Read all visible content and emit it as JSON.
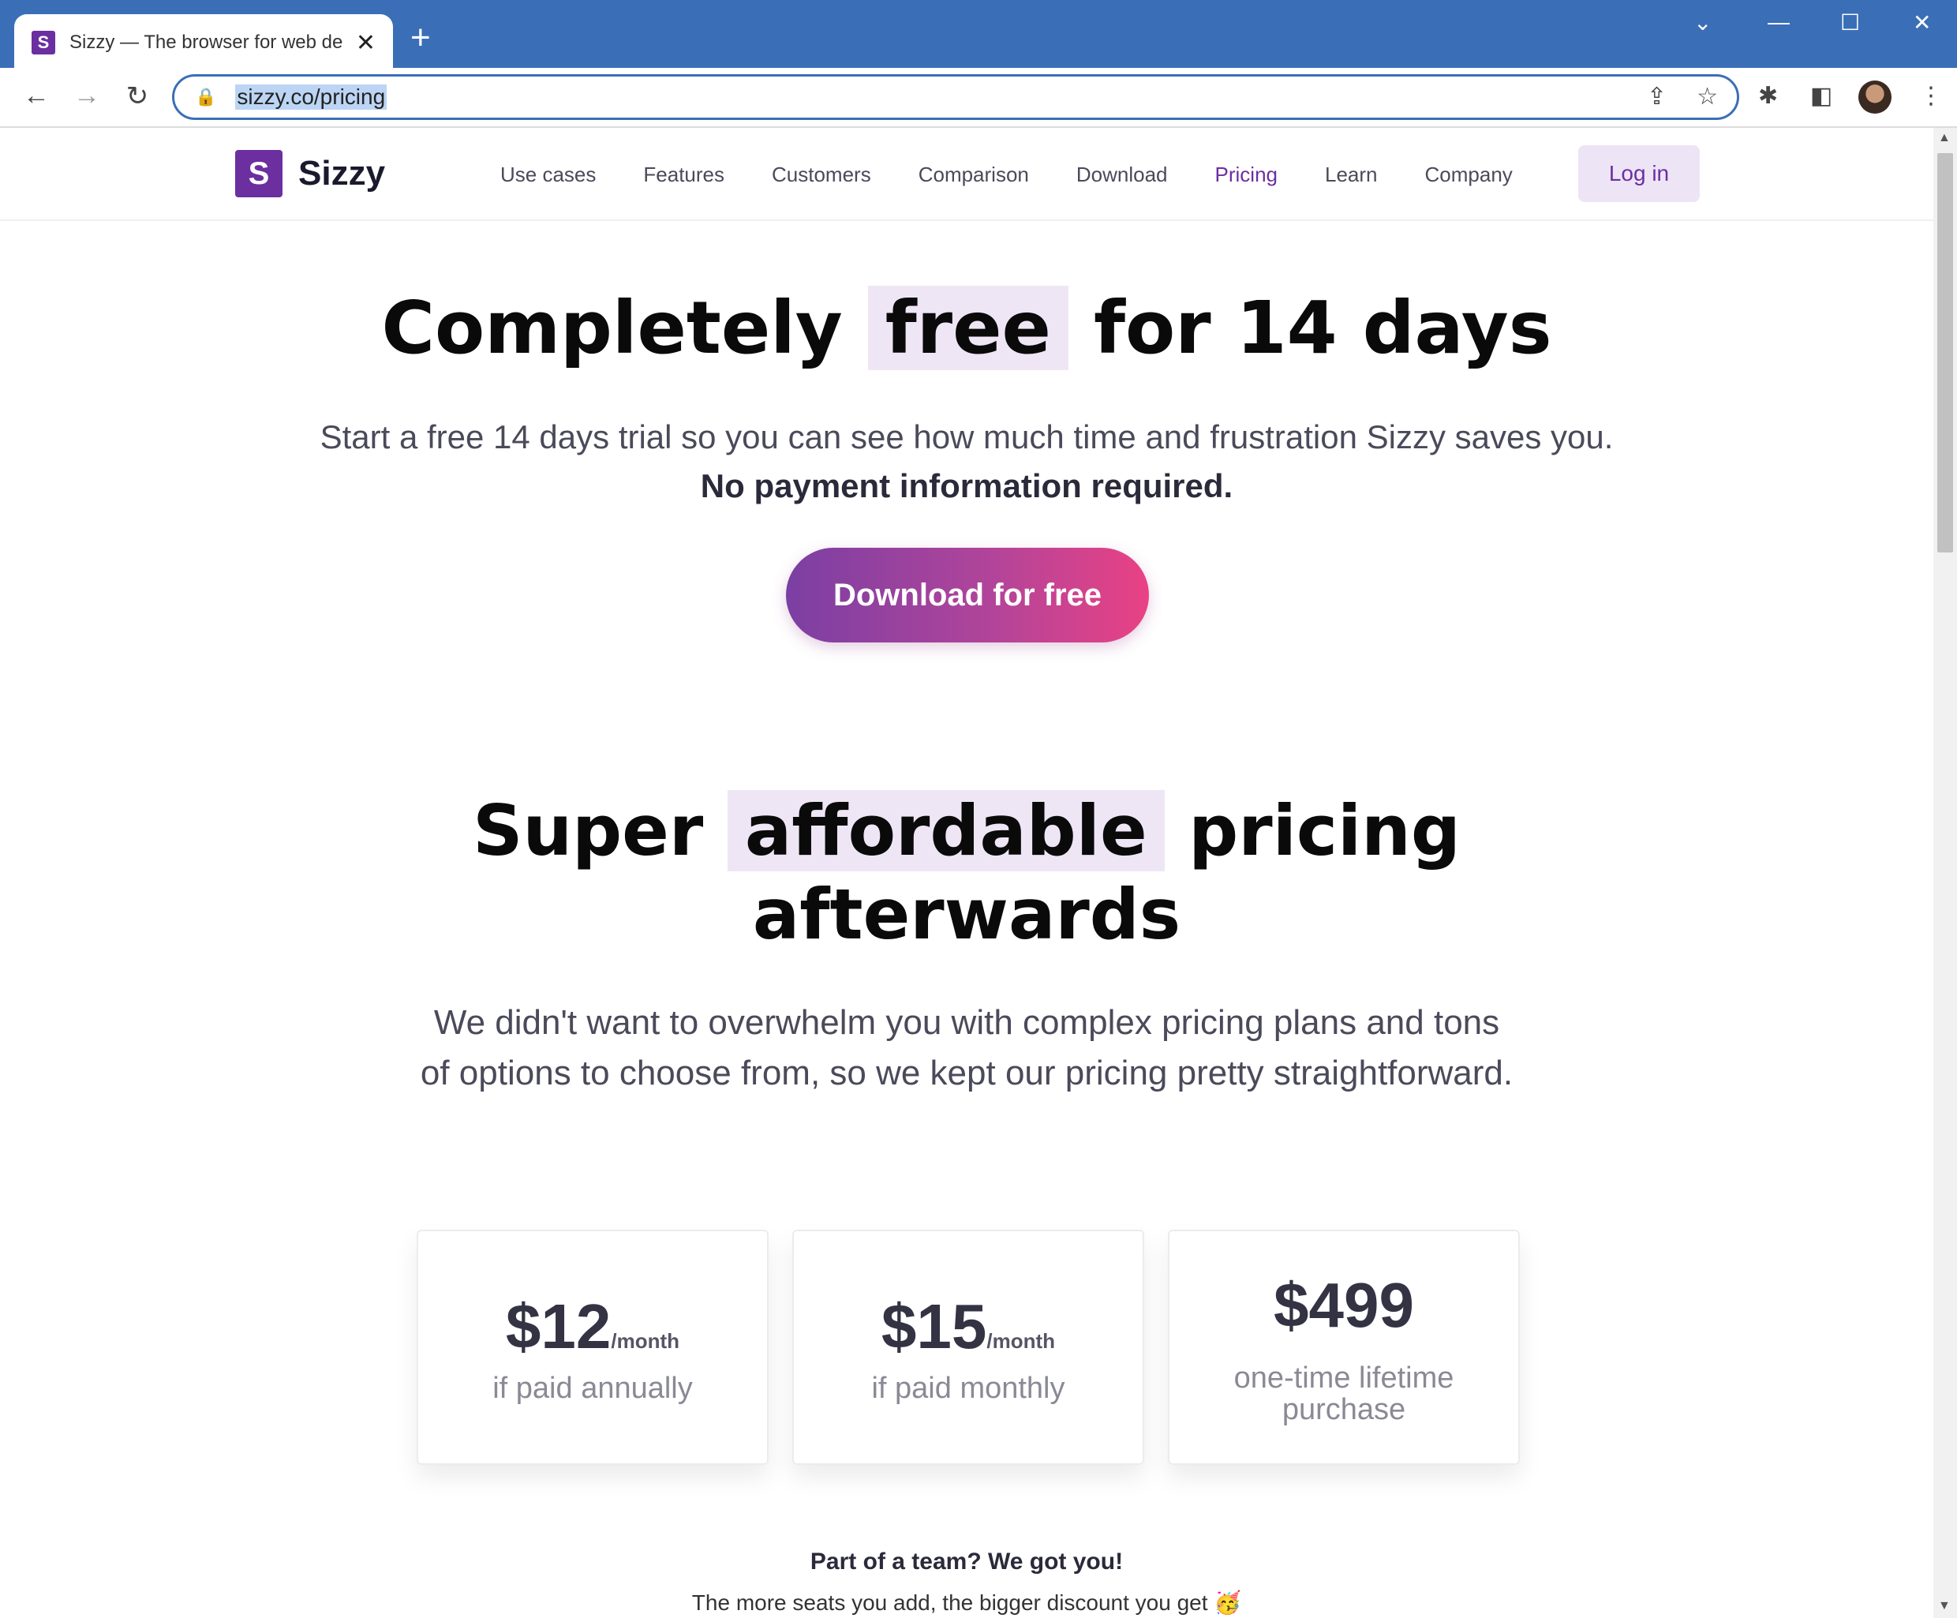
{
  "browser": {
    "tab_title": "Sizzy — The browser for web de",
    "favicon_letter": "S",
    "url": "sizzy.co/pricing"
  },
  "nav": {
    "logo_letter": "S",
    "logo_text": "Sizzy",
    "links": [
      "Use cases",
      "Features",
      "Customers",
      "Comparison",
      "Download",
      "Pricing",
      "Learn",
      "Company"
    ],
    "active": "Pricing",
    "login": "Log in"
  },
  "hero": {
    "title_pre": "Completely",
    "title_highlight": "free",
    "title_post": "for 14 days",
    "subtitle": "Start a free 14 days trial so you can see how much time and frustration Sizzy saves you.",
    "note": "No payment information required.",
    "cta": "Download for free"
  },
  "pricing": {
    "title_pre": "Super",
    "title_highlight": "affordable",
    "title_post": "pricing afterwards",
    "subtitle": "We didn't want to overwhelm you with complex pricing plans and tons of options to choose from, so we kept our pricing pretty straightforward.",
    "plans": [
      {
        "price": "$12",
        "period": "/month",
        "note": "if paid annually"
      },
      {
        "price": "$15",
        "period": "/month",
        "note": "if paid monthly"
      },
      {
        "price": "$499",
        "period": "",
        "note": "one-time lifetime purchase"
      }
    ],
    "team_title": "Part of a team? We got you!",
    "team_subtitle": "The more seats you add, the bigger discount you get 🥳"
  },
  "colors": {
    "brand": "#6b2fa0",
    "chrome": "#3a6fb8",
    "highlight": "#efe6f5",
    "cta_start": "#7b3fa3",
    "cta_end": "#e94284"
  }
}
